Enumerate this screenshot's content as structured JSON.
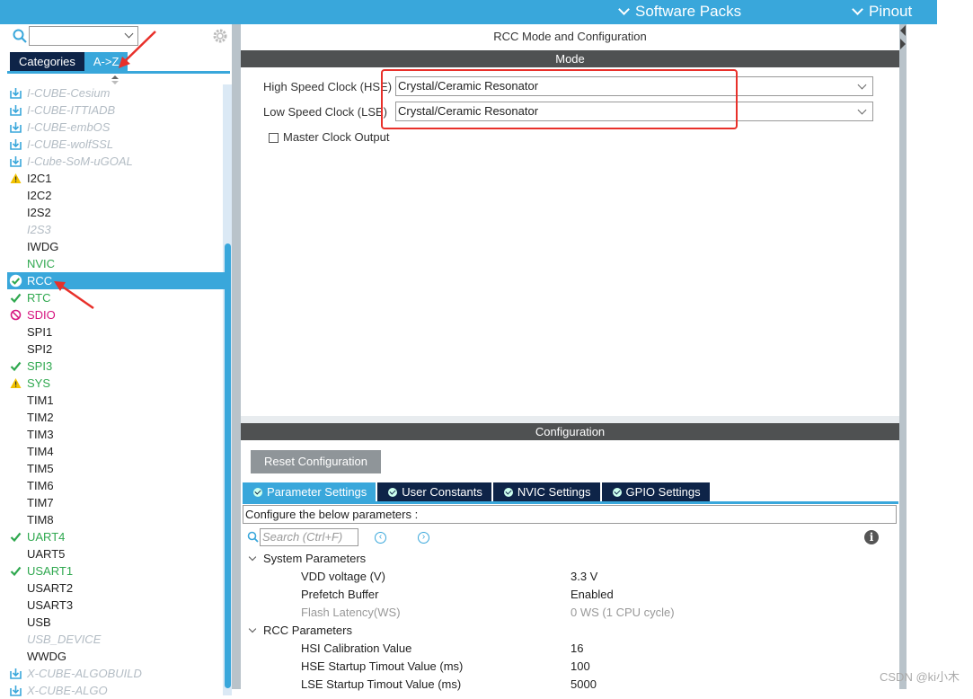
{
  "topbar": {
    "software_packs": "Software Packs",
    "pinout": "Pinout"
  },
  "sidebar": {
    "tabs": [
      {
        "label": "Categories"
      },
      {
        "label": "A->Z"
      }
    ],
    "items": [
      {
        "label": "I-CUBE-Cesium",
        "style": "gray",
        "icon": "download-icon"
      },
      {
        "label": "I-CUBE-ITTIADB",
        "style": "gray",
        "icon": "download-icon"
      },
      {
        "label": "I-CUBE-embOS",
        "style": "gray",
        "icon": "download-icon"
      },
      {
        "label": "I-CUBE-wolfSSL",
        "style": "gray",
        "icon": "download-icon"
      },
      {
        "label": "I-Cube-SoM-uGOAL",
        "style": "gray",
        "icon": "download-icon"
      },
      {
        "label": "I2C1",
        "style": "",
        "icon": "warning-icon"
      },
      {
        "label": "I2C2",
        "style": "",
        "icon": ""
      },
      {
        "label": "I2S2",
        "style": "",
        "icon": ""
      },
      {
        "label": "I2S3",
        "style": "gray",
        "icon": ""
      },
      {
        "label": "IWDG",
        "style": "",
        "icon": ""
      },
      {
        "label": "NVIC",
        "style": "green",
        "icon": ""
      },
      {
        "label": "RCC",
        "style": "sel",
        "icon": "check-circle-icon"
      },
      {
        "label": "RTC",
        "style": "green",
        "icon": "check-icon"
      },
      {
        "label": "SDIO",
        "style": "pink",
        "icon": "ban-icon"
      },
      {
        "label": "SPI1",
        "style": "",
        "icon": ""
      },
      {
        "label": "SPI2",
        "style": "",
        "icon": ""
      },
      {
        "label": "SPI3",
        "style": "green",
        "icon": "check-icon"
      },
      {
        "label": "SYS",
        "style": "green",
        "icon": "warning-icon"
      },
      {
        "label": "TIM1",
        "style": "",
        "icon": ""
      },
      {
        "label": "TIM2",
        "style": "",
        "icon": ""
      },
      {
        "label": "TIM3",
        "style": "",
        "icon": ""
      },
      {
        "label": "TIM4",
        "style": "",
        "icon": ""
      },
      {
        "label": "TIM5",
        "style": "",
        "icon": ""
      },
      {
        "label": "TIM6",
        "style": "",
        "icon": ""
      },
      {
        "label": "TIM7",
        "style": "",
        "icon": ""
      },
      {
        "label": "TIM8",
        "style": "",
        "icon": ""
      },
      {
        "label": "UART4",
        "style": "green",
        "icon": "check-icon"
      },
      {
        "label": "UART5",
        "style": "",
        "icon": ""
      },
      {
        "label": "USART1",
        "style": "green",
        "icon": "check-icon"
      },
      {
        "label": "USART2",
        "style": "",
        "icon": ""
      },
      {
        "label": "USART3",
        "style": "",
        "icon": ""
      },
      {
        "label": "USB",
        "style": "",
        "icon": ""
      },
      {
        "label": "USB_DEVICE",
        "style": "gray",
        "icon": ""
      },
      {
        "label": "WWDG",
        "style": "",
        "icon": ""
      },
      {
        "label": "X-CUBE-ALGOBUILD",
        "style": "gray",
        "icon": "download-icon"
      },
      {
        "label": "X-CUBE-ALGO",
        "style": "gray",
        "icon": "download-icon"
      }
    ]
  },
  "main": {
    "title": "RCC Mode and Configuration",
    "mode_header": "Mode",
    "hse_label": "High Speed Clock (HSE)",
    "hse_value": "Crystal/Ceramic Resonator",
    "lse_label": "Low Speed Clock (LSE)",
    "lse_value": "Crystal/Ceramic Resonator",
    "mco_label": "Master Clock Output",
    "config_header": "Configuration",
    "reset_button": "Reset Configuration",
    "tabs": [
      {
        "label": "Parameter Settings"
      },
      {
        "label": "User Constants"
      },
      {
        "label": "NVIC Settings"
      },
      {
        "label": "GPIO Settings"
      }
    ],
    "configure_text": "Configure the below parameters :",
    "search_placeholder": "Search (Ctrl+F)",
    "params": [
      {
        "group": true,
        "key": "System Parameters",
        "value": ""
      },
      {
        "key": "VDD voltage (V)",
        "value": "3.3 V"
      },
      {
        "key": "Prefetch Buffer",
        "value": "Enabled"
      },
      {
        "key": "Flash Latency(WS)",
        "value": "0 WS (1 CPU cycle)",
        "disabled": true
      },
      {
        "group": true,
        "key": "RCC Parameters",
        "value": ""
      },
      {
        "key": "HSI Calibration Value",
        "value": "16"
      },
      {
        "key": "HSE Startup Timout Value (ms)",
        "value": "100"
      },
      {
        "key": "LSE Startup Timout Value (ms)",
        "value": "5000"
      }
    ]
  },
  "watermark": "CSDN @ki小木",
  "colors": {
    "accent": "#39a7db",
    "dark_tab": "#0e2448",
    "header": "#4f5152",
    "annotation": "#e8302a"
  }
}
